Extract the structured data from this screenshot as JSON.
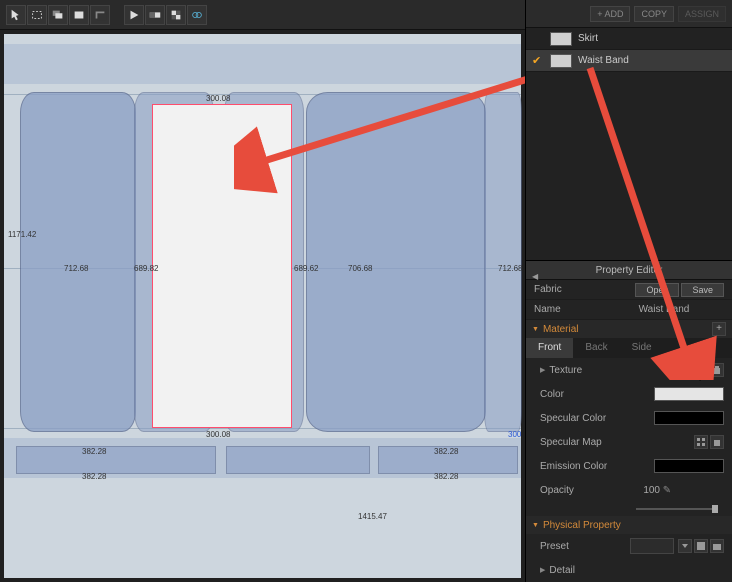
{
  "toolbar": {
    "group1": [
      "arrow-select",
      "rect-dash",
      "rect-overlap",
      "rect-solid",
      "rect-shadow"
    ],
    "group2": [
      "arrow-play",
      "layer-toggle",
      "checker",
      "link-blue"
    ]
  },
  "right_top": {
    "add": "+ ADD",
    "copy": "COPY",
    "assign": "ASSIGN"
  },
  "layers": [
    {
      "checked": false,
      "name": "Skirt"
    },
    {
      "checked": true,
      "name": "Waist Band"
    }
  ],
  "property_editor": {
    "title": "Property Editor",
    "fabric_label": "Fabric",
    "open": "Open",
    "save": "Save",
    "name_label": "Name",
    "name_value": "Waist Band",
    "material": {
      "header": "Material",
      "tabs": [
        "Front",
        "Back",
        "Side"
      ],
      "active_tab": 0,
      "texture_label": "Texture",
      "color_label": "Color",
      "color_value": "#e5e5e5",
      "spec_color_label": "Specular Color",
      "spec_color_value": "#000000",
      "spec_map_label": "Specular Map",
      "emission_label": "Emission Color",
      "emission_value": "#000000",
      "opacity_label": "Opacity",
      "opacity_value": "100"
    },
    "physical": {
      "header": "Physical Property",
      "preset_label": "Preset",
      "detail_label": "Detail"
    }
  },
  "canvas": {
    "left_ruler": [
      "1171.42",
      "1415.47"
    ],
    "dims": {
      "top_width": "300.08",
      "bottom_width": "300.08",
      "h_left": "689.82",
      "h_right": "689.62",
      "side_712": "712.68",
      "side_706": "706.68",
      "bottom_ruler_382": "382.28",
      "bottom_ruler_300": "300"
    }
  }
}
